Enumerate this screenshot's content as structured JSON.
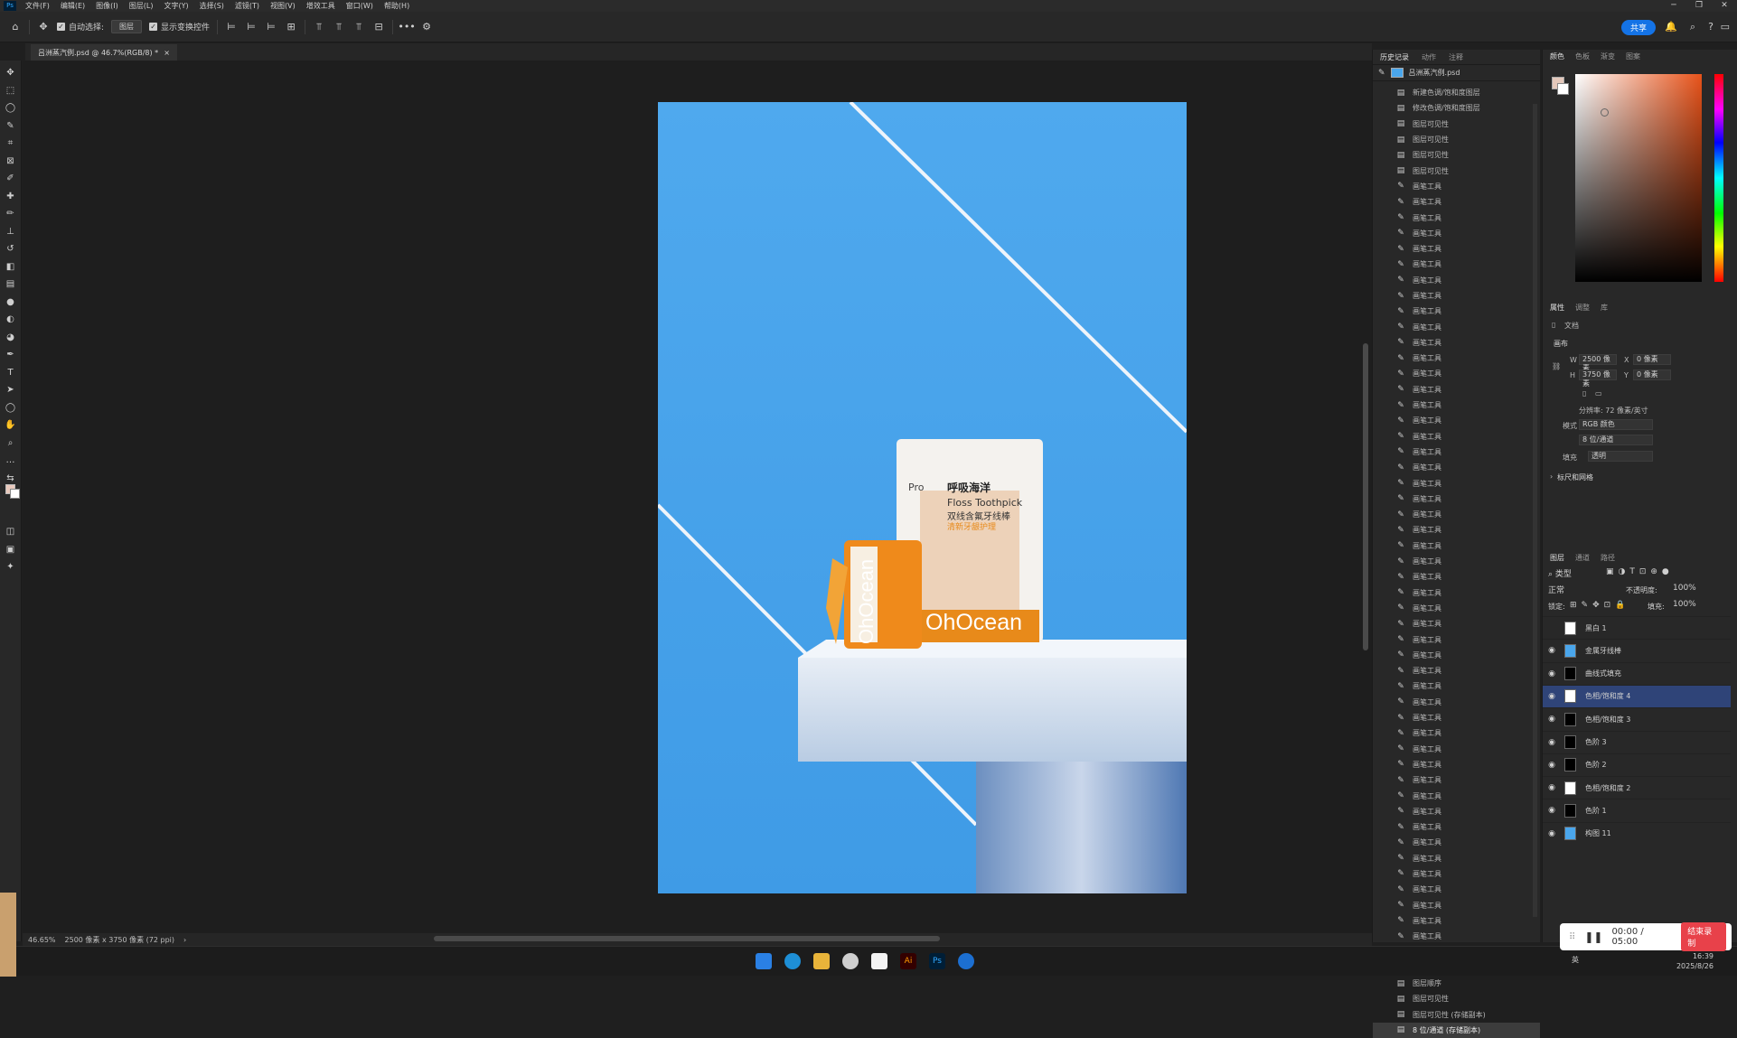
{
  "menubar": {
    "logo": "Ps",
    "items": [
      "文件(F)",
      "编辑(E)",
      "图像(I)",
      "图层(L)",
      "文字(Y)",
      "选择(S)",
      "滤镜(T)",
      "视图(V)",
      "增效工具",
      "窗口(W)",
      "帮助(H)"
    ]
  },
  "options": {
    "auto_select_label": "自动选择:",
    "layer_select_value": "图层",
    "show_transform_label": "显示变换控件",
    "share_label": "共享"
  },
  "document": {
    "tab_title": "吕洲蒸汽例.psd @ 46.7%(RGB/8) *",
    "close": "×"
  },
  "status": {
    "zoom": "46.65%",
    "info": "2500 像素 x 3750 像素 (72 ppi)",
    "arrow": "›"
  },
  "product": {
    "bag_pro": "Pro",
    "bag_title_cn": "呼吸海洋",
    "bag_title_en": "Floss Toothpick",
    "bag_sub_cn": "双线含氟牙线棒",
    "bag_tag": "清新牙龈护理",
    "bag_brand": "OhOcean",
    "box_brand": "OhOcean"
  },
  "history": {
    "tabs": [
      "历史记录",
      "动作",
      "注释"
    ],
    "snapshot": "吕洲蒸汽例.psd",
    "items": [
      {
        "icon": "doc",
        "label": "新建色调/饱和度图层"
      },
      {
        "icon": "doc",
        "label": "修改色调/饱和度图层"
      },
      {
        "icon": "doc",
        "label": "图层可见性"
      },
      {
        "icon": "doc",
        "label": "图层可见性"
      },
      {
        "icon": "doc",
        "label": "图层可见性"
      },
      {
        "icon": "doc",
        "label": "图层可见性"
      },
      {
        "icon": "brush",
        "label": "画笔工具"
      },
      {
        "icon": "brush",
        "label": "画笔工具"
      },
      {
        "icon": "brush",
        "label": "画笔工具"
      },
      {
        "icon": "brush",
        "label": "画笔工具"
      },
      {
        "icon": "brush",
        "label": "画笔工具"
      },
      {
        "icon": "brush",
        "label": "画笔工具"
      },
      {
        "icon": "brush",
        "label": "画笔工具"
      },
      {
        "icon": "brush",
        "label": "画笔工具"
      },
      {
        "icon": "brush",
        "label": "画笔工具"
      },
      {
        "icon": "brush",
        "label": "画笔工具"
      },
      {
        "icon": "brush",
        "label": "画笔工具"
      },
      {
        "icon": "brush",
        "label": "画笔工具"
      },
      {
        "icon": "brush",
        "label": "画笔工具"
      },
      {
        "icon": "brush",
        "label": "画笔工具"
      },
      {
        "icon": "brush",
        "label": "画笔工具"
      },
      {
        "icon": "brush",
        "label": "画笔工具"
      },
      {
        "icon": "brush",
        "label": "画笔工具"
      },
      {
        "icon": "brush",
        "label": "画笔工具"
      },
      {
        "icon": "brush",
        "label": "画笔工具"
      },
      {
        "icon": "brush",
        "label": "画笔工具"
      },
      {
        "icon": "brush",
        "label": "画笔工具"
      },
      {
        "icon": "brush",
        "label": "画笔工具"
      },
      {
        "icon": "brush",
        "label": "画笔工具"
      },
      {
        "icon": "brush",
        "label": "画笔工具"
      },
      {
        "icon": "brush",
        "label": "画笔工具"
      },
      {
        "icon": "brush",
        "label": "画笔工具"
      },
      {
        "icon": "brush",
        "label": "画笔工具"
      },
      {
        "icon": "brush",
        "label": "画笔工具"
      },
      {
        "icon": "brush",
        "label": "画笔工具"
      },
      {
        "icon": "brush",
        "label": "画笔工具"
      },
      {
        "icon": "brush",
        "label": "画笔工具"
      },
      {
        "icon": "brush",
        "label": "画笔工具"
      },
      {
        "icon": "brush",
        "label": "画笔工具"
      },
      {
        "icon": "brush",
        "label": "画笔工具"
      },
      {
        "icon": "brush",
        "label": "画笔工具"
      },
      {
        "icon": "brush",
        "label": "画笔工具"
      },
      {
        "icon": "brush",
        "label": "画笔工具"
      },
      {
        "icon": "brush",
        "label": "画笔工具"
      },
      {
        "icon": "brush",
        "label": "画笔工具"
      },
      {
        "icon": "brush",
        "label": "画笔工具"
      },
      {
        "icon": "brush",
        "label": "画笔工具"
      },
      {
        "icon": "brush",
        "label": "画笔工具"
      },
      {
        "icon": "brush",
        "label": "画笔工具"
      },
      {
        "icon": "brush",
        "label": "画笔工具"
      },
      {
        "icon": "brush",
        "label": "画笔工具"
      },
      {
        "icon": "brush",
        "label": "画笔工具"
      },
      {
        "icon": "brush",
        "label": "画笔工具"
      },
      {
        "icon": "brush",
        "label": "画笔工具"
      },
      {
        "icon": "brush",
        "label": "画笔工具"
      },
      {
        "icon": "brush",
        "label": "画笔工具"
      },
      {
        "icon": "brush",
        "label": "画笔工具"
      },
      {
        "icon": "doc",
        "label": "图层顺序"
      },
      {
        "icon": "doc",
        "label": "图层可见性"
      },
      {
        "icon": "doc",
        "label": "图层可见性 (存储副本)"
      },
      {
        "icon": "doc",
        "label": "8 位/通道 (存储副本)"
      }
    ]
  },
  "color_panel": {
    "tabs": [
      "颜色",
      "色板",
      "渐变",
      "图案"
    ]
  },
  "properties": {
    "tabs": [
      "属性",
      "调整",
      "库"
    ],
    "doc_label": "文档",
    "canvas_label": "画布",
    "w_label": "W",
    "w_value": "2500 像素",
    "h_label": "H",
    "h_value": "3750 像素",
    "x_label": "X",
    "x_value": "0 像素",
    "y_label": "Y",
    "y_value": "0 像素",
    "resolution": "分辨率: 72 像素/英寸",
    "mode_label": "模式",
    "mode_value": "RGB 颜色",
    "depth_value": "8 位/通道",
    "fill_label": "填充",
    "fill_value": "透明",
    "rulers_label": "标尺和网格"
  },
  "layers": {
    "tabs": [
      "图层",
      "通道",
      "路径"
    ],
    "filter": "类型",
    "blend": "正常",
    "opacity_label": "不透明度:",
    "opacity_value": "100%",
    "lock_label": "锁定:",
    "fill_label": "填充:",
    "fill_value": "100%",
    "items": [
      {
        "name": "黑白 1",
        "thumb": "white",
        "visible": false,
        "selected": false
      },
      {
        "name": "金属牙线棒",
        "thumb": "img",
        "visible": true,
        "selected": false
      },
      {
        "name": "曲线式填充",
        "thumb": "black",
        "visible": true,
        "selected": false
      },
      {
        "name": "色相/饱和度 4",
        "thumb": "white",
        "visible": true,
        "selected": true
      },
      {
        "name": "色相/饱和度 3",
        "thumb": "black",
        "visible": true,
        "selected": false
      },
      {
        "name": "色阶 3",
        "thumb": "black",
        "visible": true,
        "selected": false
      },
      {
        "name": "色阶 2",
        "thumb": "black",
        "visible": true,
        "selected": false
      },
      {
        "name": "色相/饱和度 2",
        "thumb": "white",
        "visible": true,
        "selected": false
      },
      {
        "name": "色阶 1",
        "thumb": "black",
        "visible": true,
        "selected": false
      },
      {
        "name": "构图 11",
        "thumb": "img",
        "visible": true,
        "selected": false
      }
    ]
  },
  "recorder": {
    "time": "00:00 / 05:00",
    "end_label": "结束录制"
  },
  "taskbar": {
    "lang": "英",
    "time": "16:39",
    "date": "2025/8/26"
  }
}
